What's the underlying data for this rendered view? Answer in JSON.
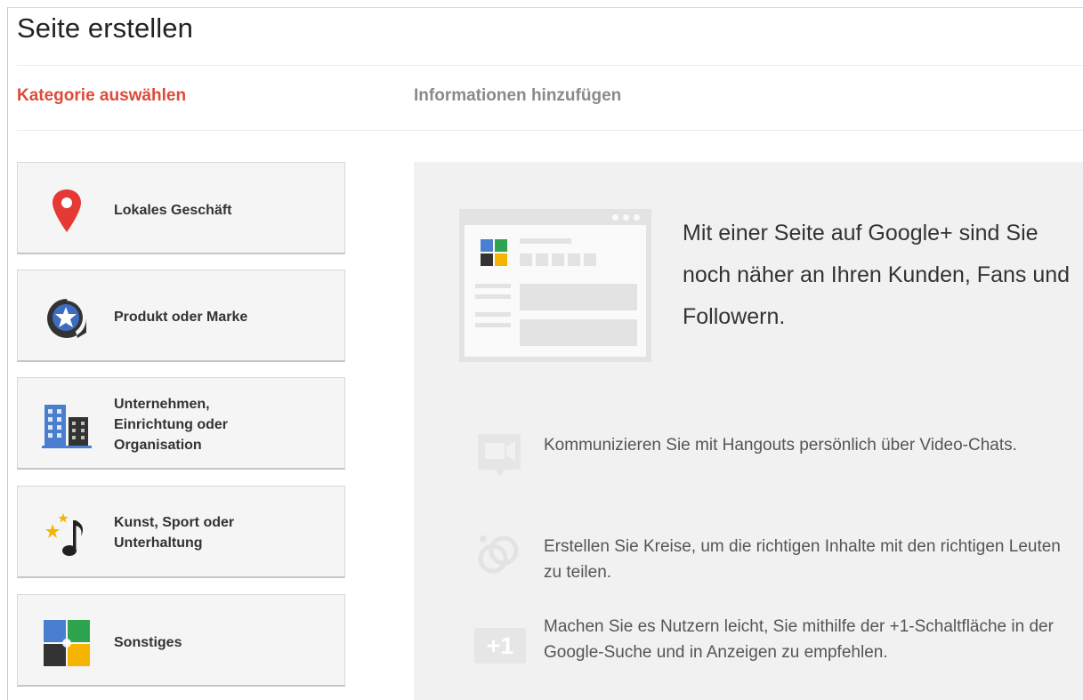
{
  "page": {
    "title": "Seite erstellen"
  },
  "steps": {
    "active": "Kategorie auswählen",
    "next": "Informationen hinzufügen"
  },
  "categories": [
    {
      "label": "Lokales Geschäft",
      "icon": "map-pin-icon"
    },
    {
      "label": "Produkt oder Marke",
      "icon": "star-tag-icon"
    },
    {
      "label": "Unternehmen,\nEinrichtung oder\nOrganisation",
      "icon": "buildings-icon"
    },
    {
      "label": "Kunst, Sport oder\nUnterhaltung",
      "icon": "music-stars-icon"
    },
    {
      "label": "Sonstiges",
      "icon": "color-squares-icon"
    }
  ],
  "panel": {
    "intro": "Mit einer Seite auf Google+ sind Sie noch näher an Ihren Kunden, Fans und Followern.",
    "features": [
      {
        "icon": "hangout-video-icon",
        "text": "Kommunizieren Sie mit Hangouts persönlich über Video-Chats."
      },
      {
        "icon": "circles-icon",
        "text": "Erstellen Sie Kreise, um die richtigen Inhalte mit den richtigen Leuten zu teilen."
      },
      {
        "icon": "plus-one-icon",
        "text": "Machen Sie es Nutzern leicht, Sie mithilfe der +1-Schaltfläche in der Google-Suche und in Anzeigen zu empfehlen."
      }
    ],
    "plus_one_glyph": "+1"
  },
  "colors": {
    "accent_red": "#dd4b39",
    "step_inactive": "#8a8a8a",
    "card_bg": "#f5f5f5",
    "panel_bg": "#f1f1f1",
    "pin_red": "#e53935",
    "tag_blue": "#3d6cc0",
    "building_blue": "#4a7fd0",
    "star_yellow": "#f4b400",
    "green": "#2ea44f"
  }
}
